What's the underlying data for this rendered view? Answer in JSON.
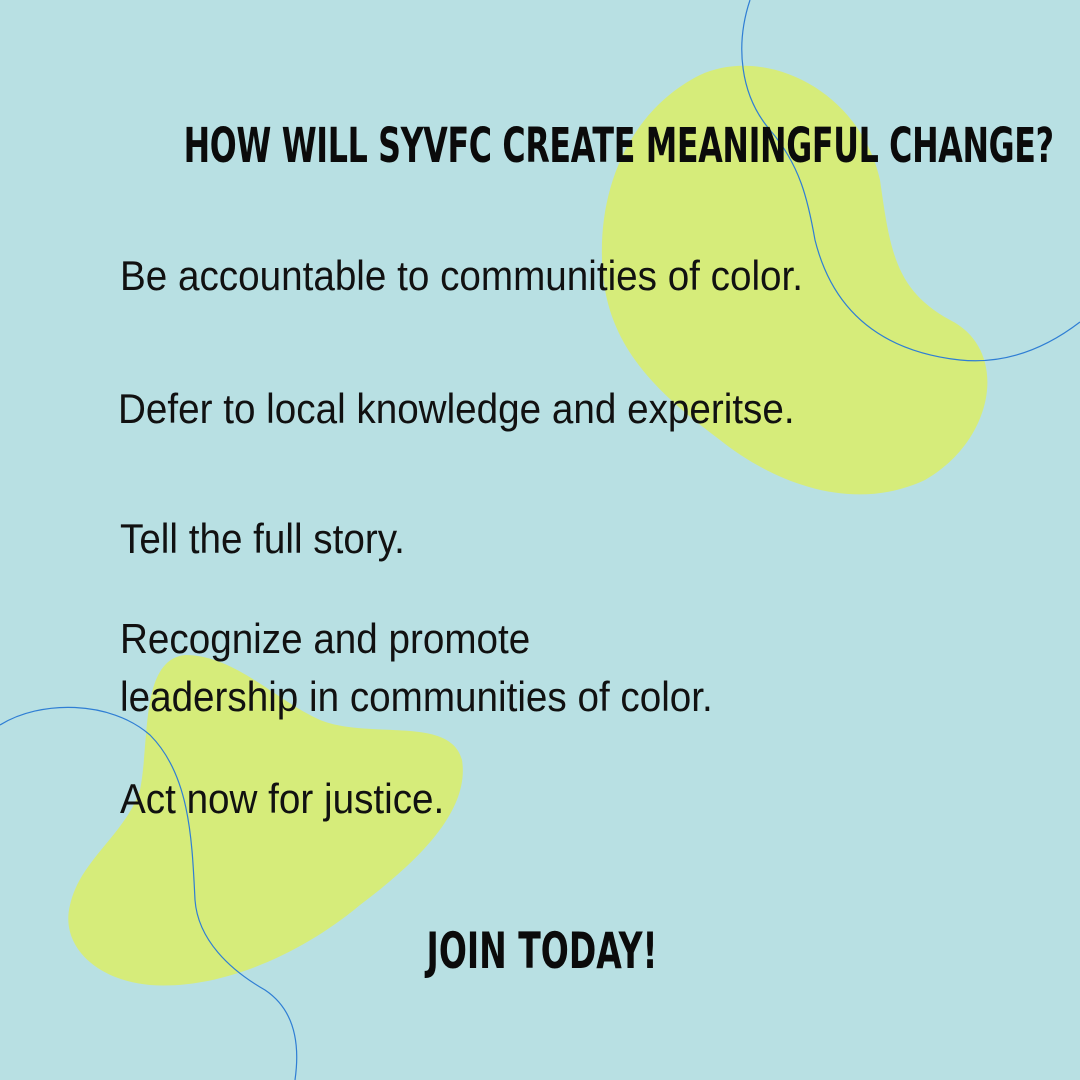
{
  "colors": {
    "background": "#b8e0e3",
    "blob": "#d6ec7a",
    "curve": "#2f7ed4",
    "text": "#0b0b0b"
  },
  "headline": "HOW WILL SYVFC CREATE MEANINGFUL CHANGE?",
  "items": [
    {
      "lines": [
        "Be accountable to communities of color."
      ]
    },
    {
      "lines": [
        "Defer to local knowledge and experitse."
      ]
    },
    {
      "lines": [
        "Tell the full story."
      ]
    },
    {
      "lines": [
        "Recognize and promote",
        "leadership in communities of color."
      ]
    },
    {
      "lines": [
        "Act now for justice."
      ]
    }
  ],
  "cta": "JOIN TODAY!"
}
